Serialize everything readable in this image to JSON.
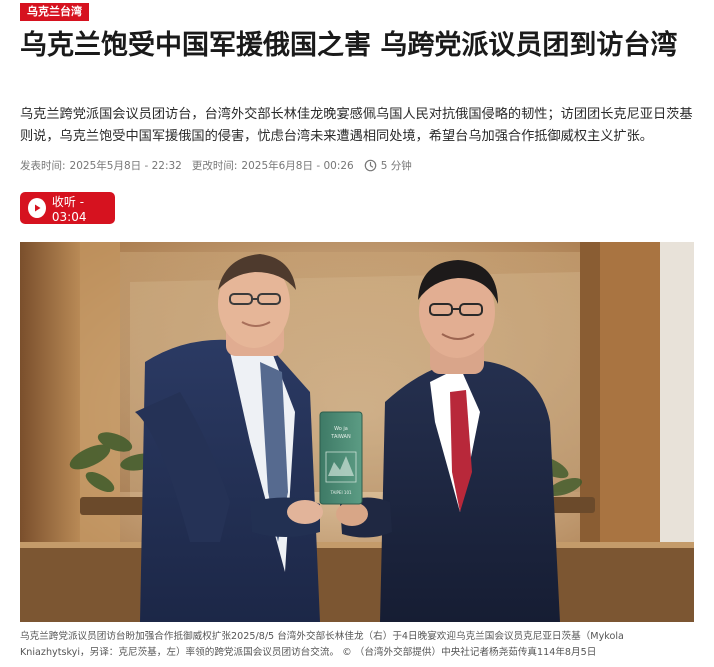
{
  "category_tag": "乌克兰台湾",
  "headline": "乌克兰饱受中国军援俄国之害 乌跨党派议员团到访台湾",
  "summary": "乌克兰跨党派国会议员团访台，台湾外交部长林佳龙晚宴感佩乌国人民对抗俄国侵略的韧性；访团团长克尼亚日茨基则说，乌克兰饱受中国军援俄国的侵害，忧虑台湾未来遭遇相同处境，希望台乌加强合作抵御威权主义扩张。",
  "meta": {
    "published_label": "发表时间:",
    "published": "2025年5月8日 - 22:32",
    "updated_label": "更改时间:",
    "updated": "2025年6月8日 - 00:26",
    "read_time": "5 分钟",
    "clock_icon": "clock-icon"
  },
  "listen": {
    "label": "收听 - 03:04",
    "icon": "play-icon"
  },
  "photo": {
    "book_text_1": "Wo ja",
    "book_text_2": "TAIWAN",
    "book_text_3": "TAIPEI 101"
  },
  "caption": "乌克兰跨党派议员团访台盼加强合作抵御威权扩张2025/8/5 台湾外交部长林佳龙（右）于4日晚宴欢迎乌克兰国会议员克尼亚日茨基（Mykola Kniazhytskyi，另译：克尼茨基，左）率领的跨党派国会议员团访台交流。 ©  （台湾外交部提供）中央社记者杨尧茹传真114年8月5日",
  "colors": {
    "accent": "#d6121f",
    "meta_text": "#777777"
  }
}
